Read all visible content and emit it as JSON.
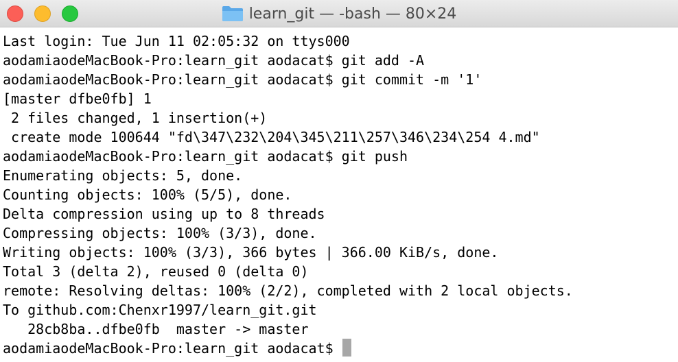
{
  "window": {
    "title": "learn_git — -bash — 80×24",
    "icon": "folder-icon"
  },
  "terminal": {
    "lines": [
      "Last login: Tue Jun 11 02:05:32 on ttys000",
      "aodamiaodeMacBook-Pro:learn_git aodacat$ git add -A",
      "aodamiaodeMacBook-Pro:learn_git aodacat$ git commit -m '1'",
      "[master dfbe0fb] 1",
      " 2 files changed, 1 insertion(+)",
      " create mode 100644 \"fd\\347\\232\\204\\345\\211\\257\\346\\234\\254 4.md\"",
      "aodamiaodeMacBook-Pro:learn_git aodacat$ git push",
      "Enumerating objects: 5, done.",
      "Counting objects: 100% (5/5), done.",
      "Delta compression using up to 8 threads",
      "Compressing objects: 100% (3/3), done.",
      "Writing objects: 100% (3/3), 366 bytes | 366.00 KiB/s, done.",
      "Total 3 (delta 2), reused 0 (delta 0)",
      "remote: Resolving deltas: 100% (2/2), completed with 2 local objects.",
      "To github.com:Chenxr1997/learn_git.git",
      "   28cb8ba..dfbe0fb  master -> master"
    ],
    "prompt": "aodamiaodeMacBook-Pro:learn_git aodacat$ "
  },
  "colors": {
    "close": "#fc5f57",
    "minimize": "#fdbc2e",
    "zoom": "#28c840",
    "folder": "#6fb7f0",
    "cursor": "#a7a7a7"
  }
}
